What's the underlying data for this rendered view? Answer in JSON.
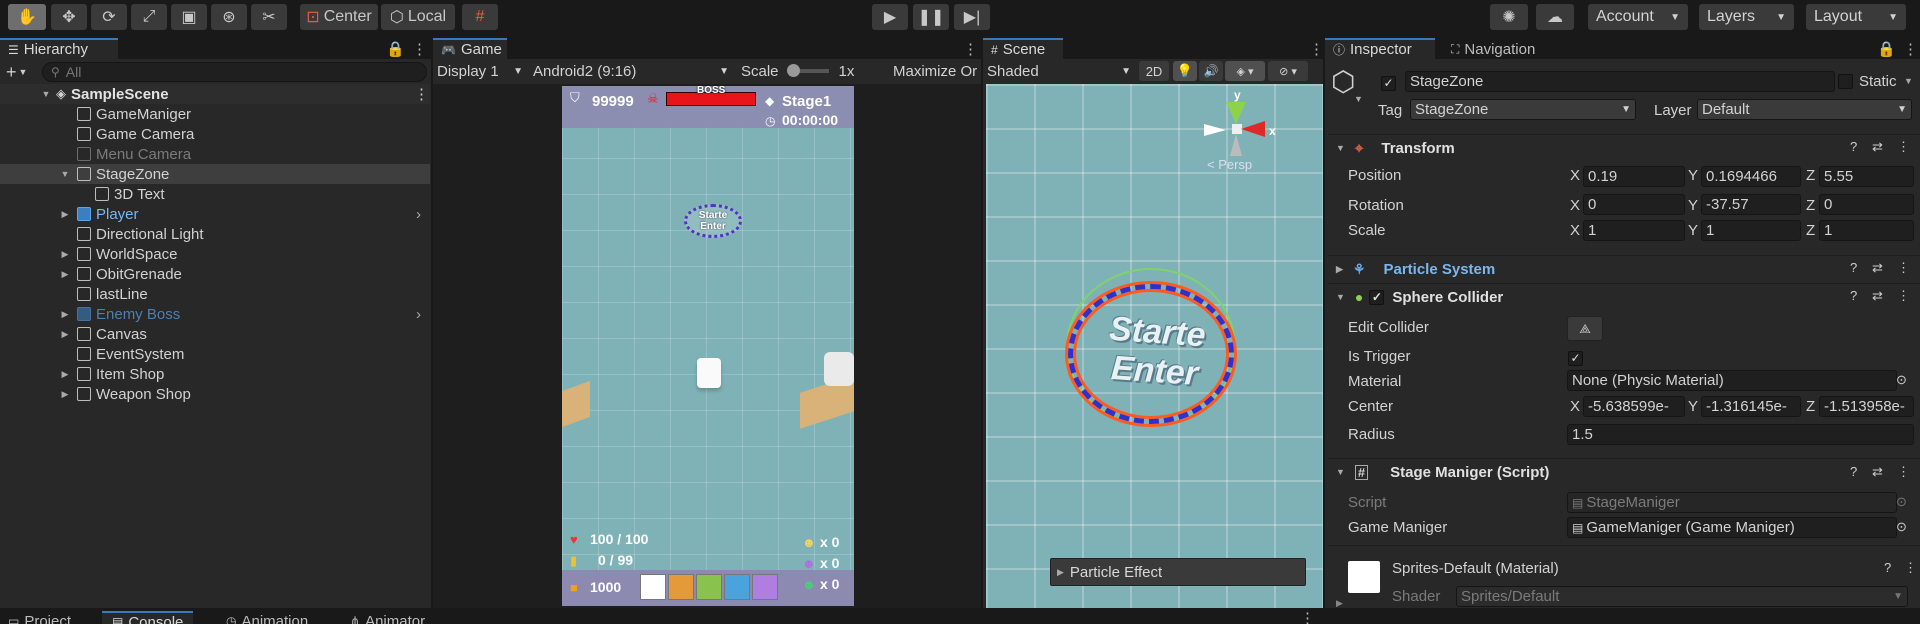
{
  "toolbar": {
    "center_label": "Center",
    "local_label": "Local",
    "account_label": "Account",
    "layers_label": "Layers",
    "layout_label": "Layout"
  },
  "hierarchy": {
    "tab_label": "Hierarchy",
    "search_placeholder": "All",
    "scene_name": "SampleScene",
    "items": [
      {
        "label": "GameManiger"
      },
      {
        "label": "Game Camera"
      },
      {
        "label": "Menu Camera"
      },
      {
        "label": "StageZone"
      },
      {
        "label": "3D Text"
      },
      {
        "label": "Player"
      },
      {
        "label": "Directional Light"
      },
      {
        "label": "WorldSpace"
      },
      {
        "label": "ObitGrenade"
      },
      {
        "label": "lastLine"
      },
      {
        "label": "Enemy Boss"
      },
      {
        "label": "Canvas"
      },
      {
        "label": "EventSystem"
      },
      {
        "label": "Item Shop"
      },
      {
        "label": "Weapon Shop"
      }
    ]
  },
  "game": {
    "tab_label": "Game",
    "display": "Display 1",
    "resolution": "Android2 (9:16)",
    "scale_label": "Scale",
    "scale_value": "1x",
    "maximize_label": "Maximize Or",
    "hud": {
      "score": "99999",
      "boss_label": "BOSS",
      "stage": "Stage1",
      "timer": "00:00:00",
      "zone_text_1": "Starte",
      "zone_text_2": "Enter",
      "health": "100 / 100",
      "ammo": "0 / 99",
      "coins": "1000",
      "count_1": "x 0",
      "count_2": "x 0",
      "count_3": "x 0"
    }
  },
  "scene": {
    "tab_label": "Scene",
    "draw_mode": "Shaded",
    "mode_2d": "2D",
    "persp_label": "< Persp",
    "gizmo_y": "y",
    "gizmo_x": "x",
    "zone_text_1": "Starte",
    "zone_text_2": "Enter",
    "particle_effect_label": "Particle Effect"
  },
  "inspector": {
    "tab_label": "Inspector",
    "nav_tab_label": "Navigation",
    "object_name": "StageZone",
    "static_label": "Static",
    "tag_label": "Tag",
    "tag_value": "StageZone",
    "layer_label": "Layer",
    "layer_value": "Default",
    "transform": {
      "title": "Transform",
      "position_label": "Position",
      "rotation_label": "Rotation",
      "scale_label": "Scale",
      "axis_x": "X",
      "axis_y": "Y",
      "axis_z": "Z",
      "position": {
        "x": "0.19",
        "y": "0.1694466",
        "z": "5.55"
      },
      "rotation": {
        "x": "0",
        "y": "-37.57",
        "z": "0"
      },
      "scale": {
        "x": "1",
        "y": "1",
        "z": "1"
      }
    },
    "particle_system_title": "Particle System",
    "sphere_collider": {
      "title": "Sphere Collider",
      "edit_collider_label": "Edit Collider",
      "is_trigger_label": "Is Trigger",
      "material_label": "Material",
      "material_value": "None (Physic Material)",
      "center_label": "Center",
      "center": {
        "x": "-5.638599e-",
        "y": "-1.316145e-",
        "z": "-1.513958e-"
      },
      "radius_label": "Radius",
      "radius_value": "1.5"
    },
    "stage_maniger": {
      "title": "Stage Maniger (Script)",
      "script_label": "Script",
      "script_value": "StageManiger",
      "game_maniger_label": "Game Maniger",
      "game_maniger_value": "GameManiger (Game Maniger)"
    },
    "material": {
      "title": "Sprites-Default (Material)",
      "shader_label": "Shader",
      "shader_value": "Sprites/Default"
    }
  },
  "bottom_tabs": [
    "Project",
    "Console",
    "Animation",
    "Animator"
  ],
  "colors": {
    "accent": "#3a79bb",
    "panel": "#282828",
    "toolbar": "#191919",
    "floor": "#7fb2b6"
  }
}
